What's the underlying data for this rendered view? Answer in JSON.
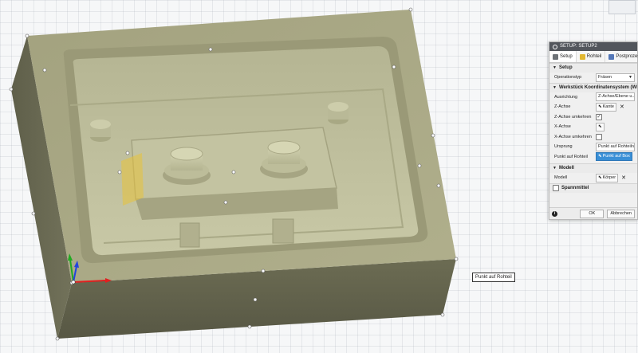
{
  "tooltip": "Punkt auf Rohteil",
  "panel": {
    "title": "SETUP: SETUP2",
    "tabs": [
      {
        "label": "Setup"
      },
      {
        "label": "Rohteil"
      },
      {
        "label": "Postprozess"
      }
    ],
    "setup": {
      "header": "Setup",
      "operation_type_label": "Operationstyp",
      "operation_type_value": "Fräsen"
    },
    "wcs": {
      "header": "Werkstück Koordinatensystem (WKS)",
      "orientation_label": "Ausrichtung",
      "orientation_value": "Z-Achse/Ebene u...",
      "z_axis_label": "Z-Achse",
      "z_axis_value": "Kante",
      "flip_z_label": "Z-Achse umkehren",
      "flip_z_checked": true,
      "x_axis_label": "X-Achse",
      "flip_x_label": "X-Achse umkehren",
      "flip_x_checked": false,
      "origin_label": "Ursprung",
      "origin_value": "Punkt auf Rohteilra...",
      "stock_point_label": "Punkt auf Rohteil",
      "stock_point_value": "Punkt auf Box"
    },
    "model": {
      "header": "Modell",
      "model_label": "Modell",
      "model_value": "Körper"
    },
    "fixture": {
      "header": "Spannmittel"
    },
    "footer": {
      "ok_label": "OK",
      "cancel_label": "Abbrechen"
    }
  },
  "colors": {
    "accent": "#3a8fd6",
    "part_side": "#64644c",
    "part_top": "#a6a582",
    "pocket_floor": "#c2c29e",
    "axis_x": "#e02020",
    "axis_y": "#22aa22",
    "axis_z": "#2244dd"
  }
}
